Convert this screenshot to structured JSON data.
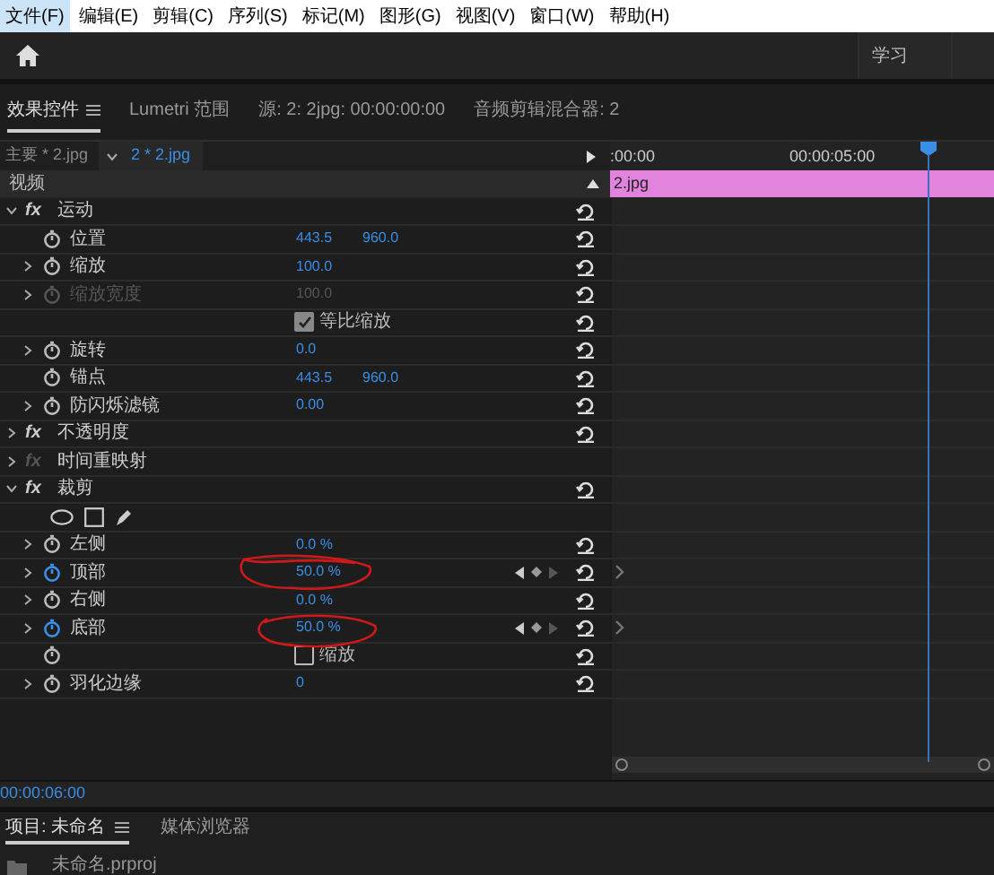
{
  "menu": [
    {
      "label": "文件(F)",
      "selected": true
    },
    {
      "label": "编辑(E)",
      "selected": false
    },
    {
      "label": "剪辑(C)",
      "selected": false
    },
    {
      "label": "序列(S)",
      "selected": false
    },
    {
      "label": "标记(M)",
      "selected": false
    },
    {
      "label": "图形(G)",
      "selected": false
    },
    {
      "label": "视图(V)",
      "selected": false
    },
    {
      "label": "窗口(W)",
      "selected": false
    },
    {
      "label": "帮助(H)",
      "selected": false
    }
  ],
  "workspaces": [
    "学习"
  ],
  "panel_tabs": [
    {
      "label": "效果控件",
      "selected": true
    },
    {
      "label": "Lumetri 范围",
      "selected": false
    },
    {
      "label": "源: 2: 2jpg: 00:00:00:00",
      "selected": false
    },
    {
      "label": "音频剪辑混合器: 2",
      "selected": false
    }
  ],
  "clip_selector": {
    "master": "主要 * 2.jpg",
    "clip": "2 * 2.jpg"
  },
  "timeline": {
    "ruler": [
      ":00:00",
      "00:00:05:00"
    ],
    "clip": "2.jpg",
    "playhead": {
      "level": 0.83
    }
  },
  "section": "视频",
  "effects": [
    {
      "badge": "fx",
      "name": "运动",
      "expanded": true,
      "enabled": true,
      "resettable": true,
      "children": [
        {
          "kind": "property",
          "label": "位置",
          "values": [
            "443.5",
            "960.0"
          ],
          "expandable": false,
          "animated": false,
          "disabled": false,
          "keyframe_nav": false
        },
        {
          "kind": "property",
          "label": "缩放",
          "values": [
            "100.0"
          ],
          "expandable": true,
          "animated": false,
          "disabled": false,
          "keyframe_nav": false
        },
        {
          "kind": "property",
          "label": "缩放宽度",
          "values": [
            "100.0"
          ],
          "expandable": true,
          "animated": false,
          "disabled": true,
          "keyframe_nav": false
        },
        {
          "kind": "checkbox",
          "label": "等比缩放",
          "checked": true,
          "stopwatch": false
        },
        {
          "kind": "property",
          "label": "旋转",
          "values": [
            "0.0"
          ],
          "expandable": true,
          "animated": false,
          "disabled": false,
          "keyframe_nav": false
        },
        {
          "kind": "property",
          "label": "锚点",
          "values": [
            "443.5",
            "960.0"
          ],
          "expandable": false,
          "animated": false,
          "disabled": false,
          "keyframe_nav": false
        },
        {
          "kind": "property",
          "label": "防闪烁滤镜",
          "values": [
            "0.00"
          ],
          "expandable": true,
          "animated": false,
          "disabled": false,
          "keyframe_nav": false
        }
      ]
    },
    {
      "badge": "fx",
      "name": "不透明度",
      "expanded": false,
      "enabled": true,
      "resettable": true
    },
    {
      "badge": "fx",
      "name": "时间重映射",
      "expanded": false,
      "enabled": false,
      "resettable": false
    },
    {
      "badge": "fx",
      "name": "裁剪",
      "expanded": true,
      "enabled": true,
      "resettable": true,
      "children": [
        {
          "kind": "mask_tools"
        },
        {
          "kind": "property",
          "label": "左侧",
          "values": [
            "0.0 %"
          ],
          "expandable": true,
          "animated": false,
          "disabled": false,
          "keyframe_nav": false
        },
        {
          "kind": "property",
          "label": "顶部",
          "values": [
            "50.0 %"
          ],
          "expandable": true,
          "animated": true,
          "disabled": false,
          "keyframe_nav": true
        },
        {
          "kind": "property",
          "label": "右侧",
          "values": [
            "0.0 %"
          ],
          "expandable": true,
          "animated": false,
          "disabled": false,
          "keyframe_nav": false
        },
        {
          "kind": "property",
          "label": "底部",
          "values": [
            "50.0 %"
          ],
          "expandable": true,
          "animated": true,
          "disabled": false,
          "keyframe_nav": true
        },
        {
          "kind": "checkbox",
          "label": "缩放",
          "checked": false,
          "stopwatch": true
        },
        {
          "kind": "property",
          "label": "羽化边缘",
          "values": [
            "0"
          ],
          "expandable": true,
          "animated": false,
          "disabled": false,
          "keyframe_nav": false
        }
      ]
    }
  ],
  "timecode": "00:00:06:00",
  "bottom_tabs": [
    {
      "label": "项目: 未命名",
      "selected": true
    },
    {
      "label": "媒体浏览器",
      "selected": false
    }
  ],
  "project_item": "未命名.prproj"
}
